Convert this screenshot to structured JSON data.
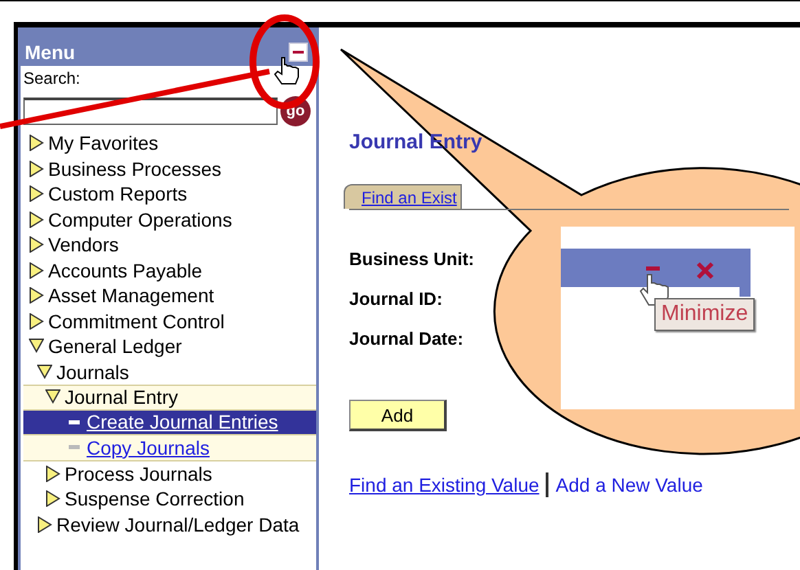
{
  "menu": {
    "title": "Menu",
    "search_label": "Search:",
    "search_button": "go",
    "items": [
      {
        "label": "My Favorites",
        "kind": "folder",
        "expanded": false
      },
      {
        "label": "Business Processes",
        "kind": "folder",
        "expanded": false
      },
      {
        "label": "Custom Reports",
        "kind": "folder",
        "expanded": false
      },
      {
        "label": "Computer Operations",
        "kind": "folder",
        "expanded": false
      },
      {
        "label": "Vendors",
        "kind": "folder",
        "expanded": false
      },
      {
        "label": "Accounts Payable",
        "kind": "folder",
        "expanded": false
      },
      {
        "label": "Asset Management",
        "kind": "folder",
        "expanded": false
      },
      {
        "label": "Commitment Control",
        "kind": "folder",
        "expanded": false
      },
      {
        "label": "General Ledger",
        "kind": "folder",
        "expanded": true,
        "children": [
          {
            "label": "Journals",
            "kind": "folder",
            "expanded": true,
            "children": [
              {
                "label": "Journal Entry",
                "kind": "folder",
                "expanded": true,
                "children": [
                  {
                    "label": "Create Journal Entries",
                    "kind": "link",
                    "selected": true
                  },
                  {
                    "label": "Copy Journals",
                    "kind": "link",
                    "selected": false
                  }
                ]
              },
              {
                "label": "Process Journals",
                "kind": "folder",
                "expanded": false
              },
              {
                "label": "Suspense Correction",
                "kind": "folder",
                "expanded": false
              }
            ]
          },
          {
            "label": "Review Journal/Ledger Data",
            "kind": "folder",
            "expanded": false
          }
        ]
      }
    ]
  },
  "page": {
    "title": "Journal Entry",
    "tabs": [
      {
        "label": "Find an Exist",
        "selected": true
      }
    ],
    "fields": [
      "Business Unit:",
      "Journal ID:",
      "Journal Date:"
    ],
    "add_button": "Add",
    "links": [
      {
        "label": "Find an Existing Value",
        "kind": "link"
      },
      {
        "label": "Add a New Value",
        "kind": "current"
      }
    ]
  },
  "callout": {
    "tooltip": "Minimize"
  }
}
